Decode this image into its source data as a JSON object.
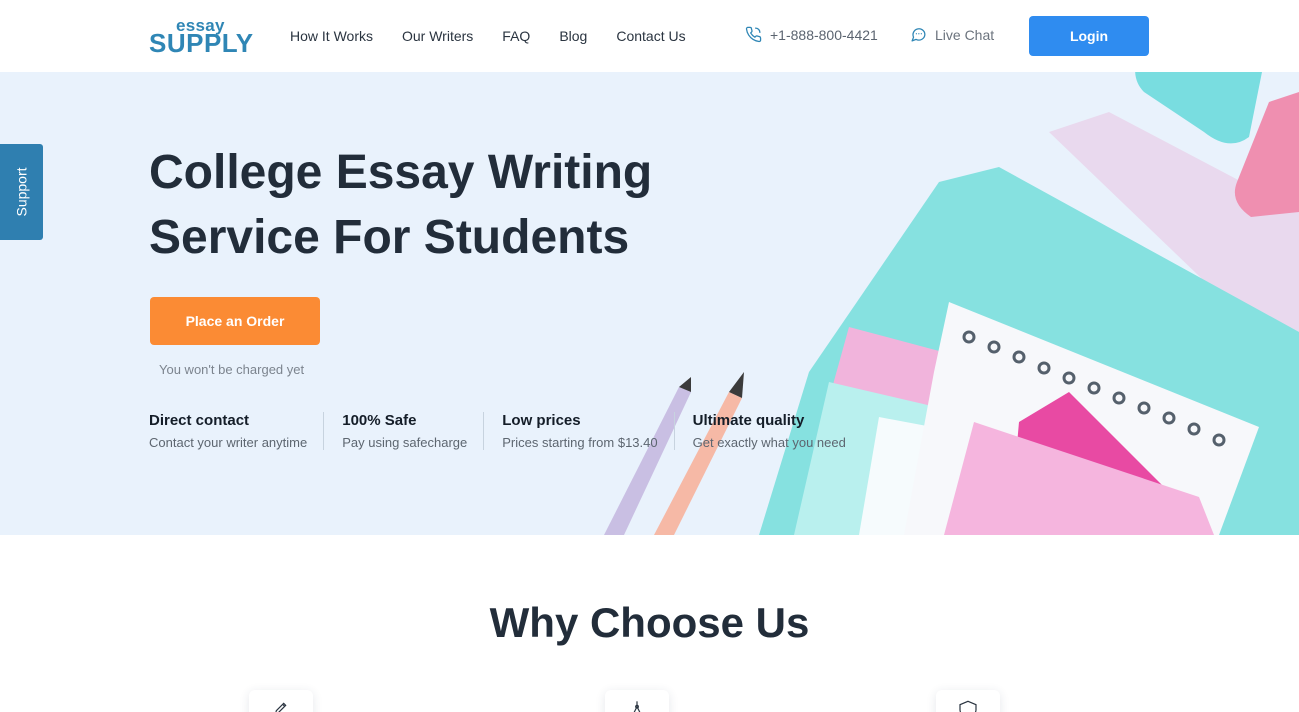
{
  "header": {
    "logo_small": "essay",
    "logo_big": "SUPPLY",
    "nav": [
      "How It Works",
      "Our Writers",
      "FAQ",
      "Blog",
      "Contact Us"
    ],
    "phone": "+1-888-800-4421",
    "chat": "Live Chat",
    "login": "Login"
  },
  "support_tab": "Support",
  "hero": {
    "title_line1": "College Essay Writing",
    "title_line2": "Service For Students",
    "order_button": "Place an Order",
    "charged_note": "You won't be charged yet",
    "features": [
      {
        "title": "Direct contact",
        "desc": "Contact your writer anytime"
      },
      {
        "title": "100% Safe",
        "desc": "Pay using safecharge"
      },
      {
        "title": "Low prices",
        "desc": "Prices starting from $13.40"
      },
      {
        "title": "Ultimate quality",
        "desc": "Get exactly what you need"
      }
    ]
  },
  "why": {
    "title": "Why Choose Us",
    "icons": [
      "pen-icon",
      "compass-icon",
      "shield-icon"
    ]
  },
  "colors": {
    "brand": "#2f86b5",
    "login": "#2f8cf0",
    "order": "#fb8b34",
    "hero_bg": "#e9f2fc"
  }
}
